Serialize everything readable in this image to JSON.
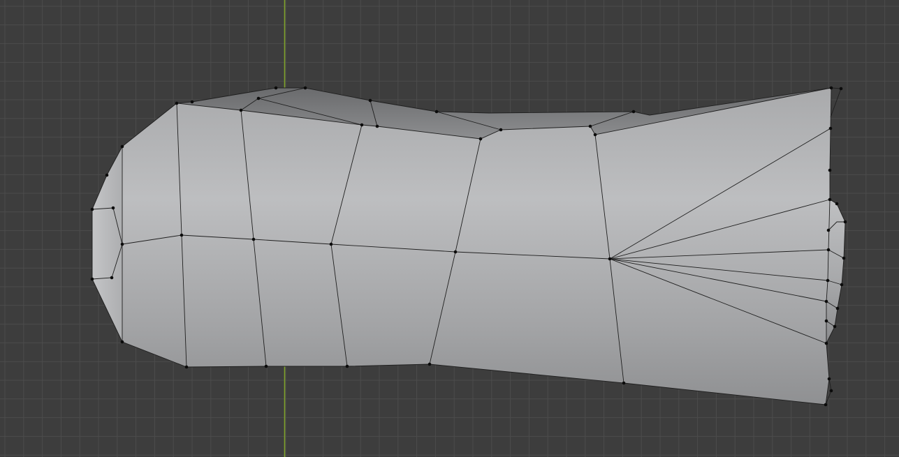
{
  "viewport": {
    "background_color": "#3d3d3d",
    "grid_color": "#4c4c4c",
    "y_axis_color": "#7ea22a",
    "mesh_color": "#b5b6b8",
    "edge_color": "#1e1e1e",
    "vertex_color": "#0b0b0b",
    "mode": "edit-mode-wireframe-overlay"
  }
}
